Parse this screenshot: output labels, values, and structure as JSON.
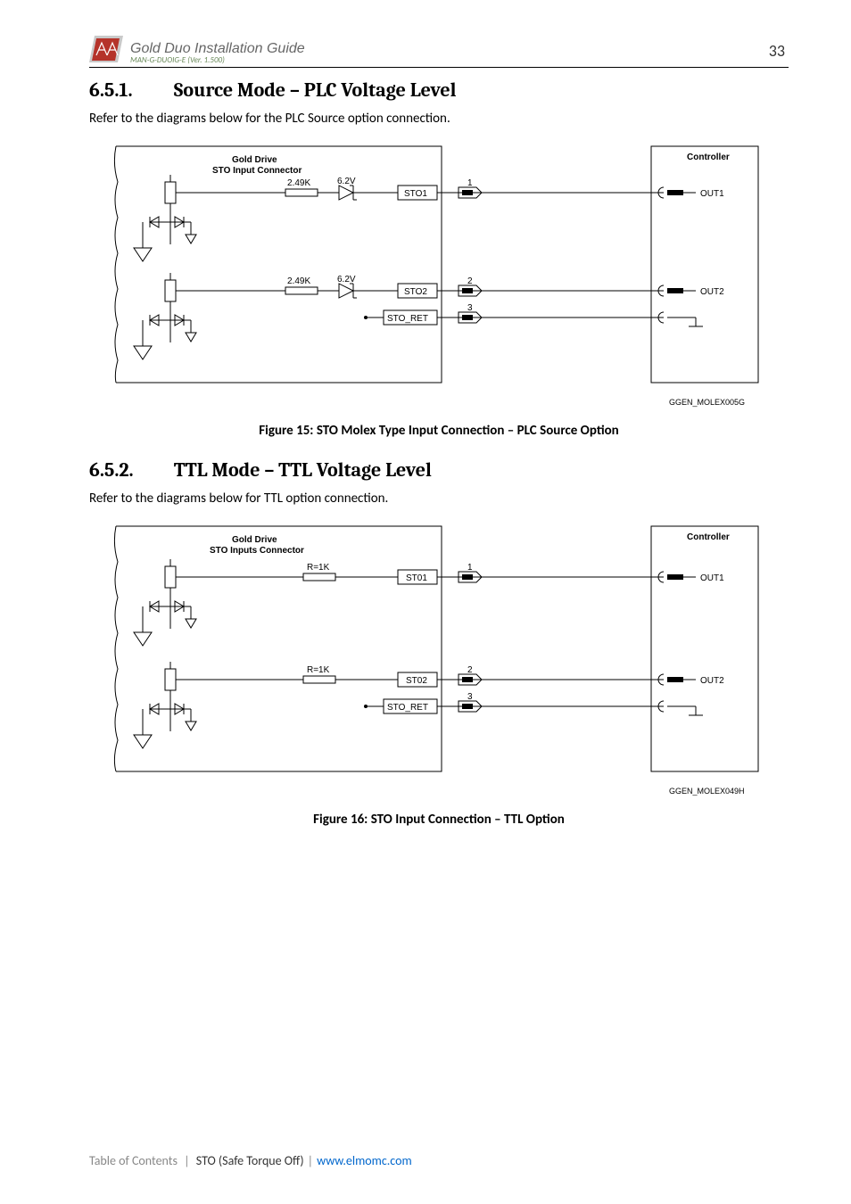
{
  "header": {
    "doc_title": "Gold Duo Installation Guide",
    "doc_sub": "MAN-G-DUOIG-E (Ver. 1.500)",
    "page_number": "33"
  },
  "section1": {
    "number": "6.5.1.",
    "title": "Source Mode – PLC Voltage Level",
    "intro": "Refer to the diagrams below for the PLC Source option connection."
  },
  "figure1": {
    "box_left_l1": "Gold Drive",
    "box_left_l2": "STO Input Connector",
    "box_right": "Controller",
    "r1": "2.49K",
    "z1": "6.2V",
    "r2": "2.49K",
    "z2": "6.2V",
    "sto1": "STO1",
    "sto2": "STO2",
    "stor": "STO_RET",
    "p1": "1",
    "p2": "2",
    "p3": "3",
    "out1": "OUT1",
    "out2": "OUT2",
    "ref": "GGEN_MOLEX005G",
    "caption": "Figure 15: STO Molex Type Input Connection – PLC Source Option"
  },
  "section2": {
    "number": "6.5.2.",
    "title": "TTL Mode – TTL Voltage Level",
    "intro": "Refer to the diagrams below for TTL option connection."
  },
  "figure2": {
    "box_left_l1": "Gold Drive",
    "box_left_l2": "STO Inputs Connector",
    "box_right": "Controller",
    "r1": "R=1K",
    "r2": "R=1K",
    "sto1": "ST01",
    "sto2": "ST02",
    "stor": "STO_RET",
    "p1": "1",
    "p2": "2",
    "p3": "3",
    "out1": "OUT1",
    "out2": "OUT2",
    "ref": "GGEN_MOLEX049H",
    "caption": "Figure 16: STO Input Connection – TTL Option"
  },
  "footer": {
    "toc": "Table of Contents",
    "sep": "|",
    "chapter": "STO (Safe Torque Off)",
    "url": "www.elmomc.com"
  }
}
